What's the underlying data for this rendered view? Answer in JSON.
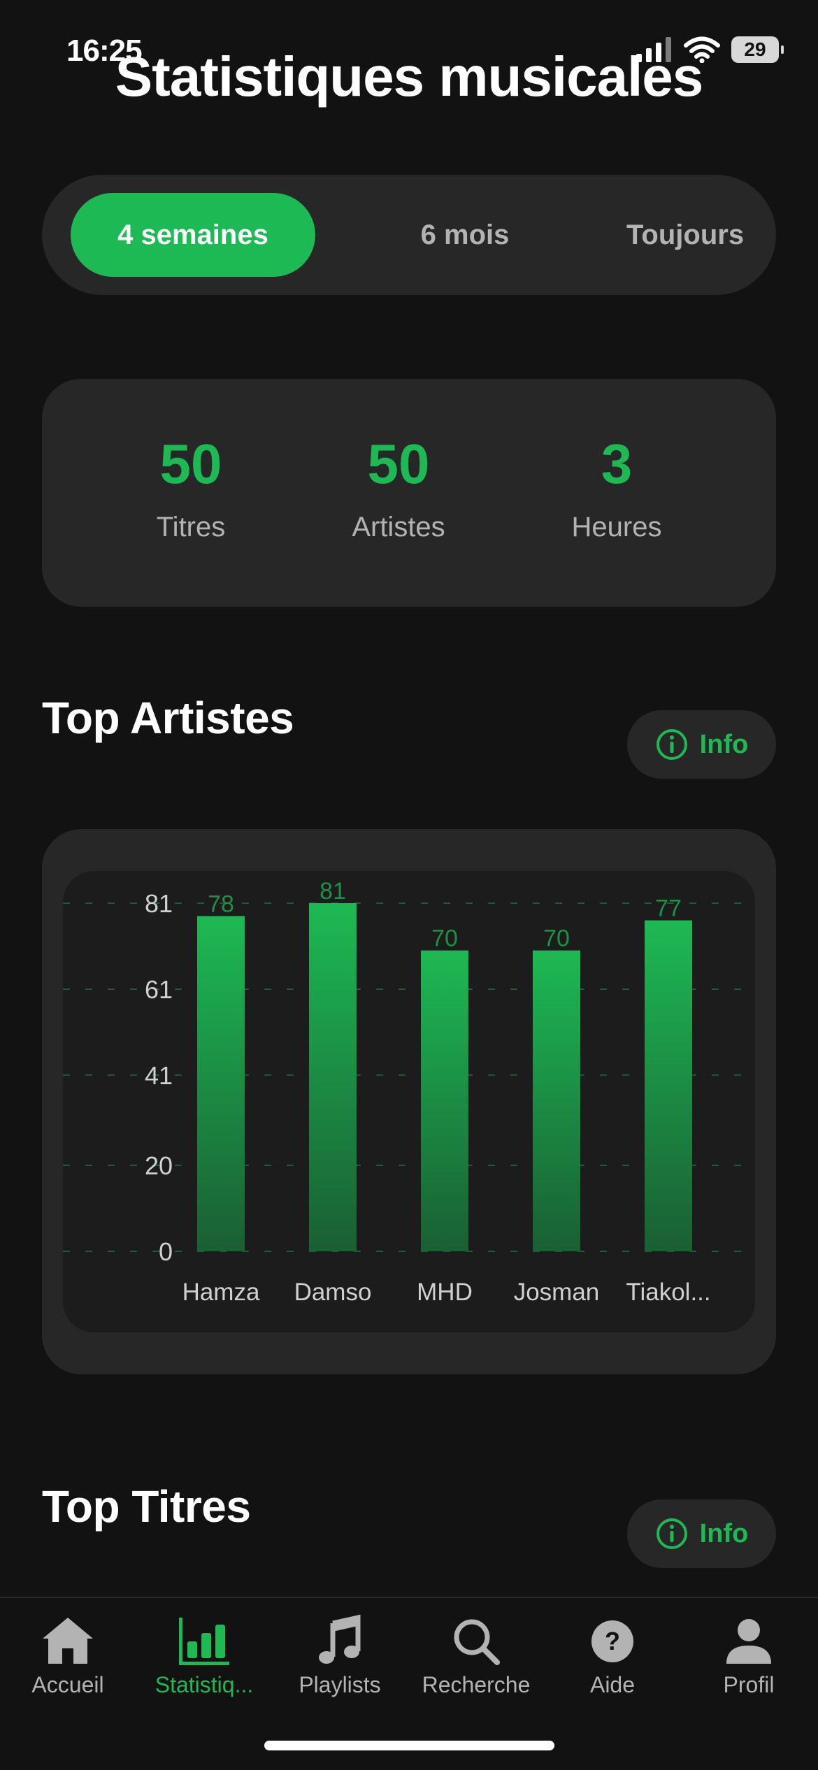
{
  "status_bar": {
    "time": "16:25",
    "battery": "29"
  },
  "title": "Statistiques musicales",
  "periods": [
    "4 semaines",
    "6 mois",
    "Toujours"
  ],
  "active_period": "4 semaines",
  "stats": [
    {
      "value": "50",
      "label": "Titres"
    },
    {
      "value": "50",
      "label": "Artistes"
    },
    {
      "value": "3",
      "label": "Heures"
    }
  ],
  "top_artists": {
    "title": "Top Artistes",
    "info_label": "Info"
  },
  "top_tracks": {
    "title": "Top Titres",
    "info_label": "Info"
  },
  "chart_data": {
    "type": "bar",
    "categories": [
      "Hamza",
      "Damso",
      "MHD",
      "Josman",
      "Tiakol..."
    ],
    "values": [
      78,
      81,
      70,
      70,
      77
    ],
    "yticks": [
      "0",
      "20",
      "41",
      "61",
      "81"
    ],
    "ylim": [
      0,
      81
    ],
    "grid": true,
    "bar_color": "#1db954",
    "data_labels": true
  },
  "tabs": [
    {
      "label": "Accueil",
      "icon": "house-icon"
    },
    {
      "label": "Statistiq...",
      "icon": "bar-chart-icon"
    },
    {
      "label": "Playlists",
      "icon": "music-note-icon"
    },
    {
      "label": "Recherche",
      "icon": "search-icon"
    },
    {
      "label": "Aide",
      "icon": "help-icon"
    },
    {
      "label": "Profil",
      "icon": "person-icon"
    }
  ],
  "active_tab": "Statistiq...",
  "colors": {
    "accent": "#1db954",
    "background": "#121212",
    "card": "#272727",
    "muted_text": "#b3b3b3"
  }
}
